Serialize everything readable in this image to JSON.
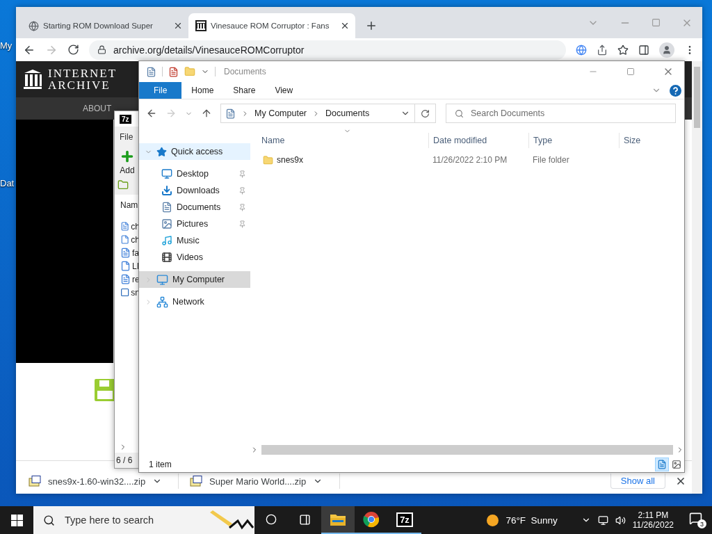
{
  "desktop": {
    "icons": [
      {
        "label": "My"
      },
      {
        "label": "Dat"
      }
    ]
  },
  "browser": {
    "tabs": [
      {
        "title": "Starting ROM Download Super",
        "selected": false
      },
      {
        "title": "Vinesauce ROM Corruptor : Fans",
        "selected": true
      }
    ],
    "url": "archive.org/details/VinesauceROMCorruptor",
    "site": {
      "logo_lines": [
        "INTERNET",
        "ARCHIVE"
      ],
      "nav": "ABOUT"
    },
    "downloads": [
      {
        "name": "snes9x-1.60-win32....zip"
      },
      {
        "name": "Super Mario World....zip"
      }
    ],
    "show_all": "Show all"
  },
  "archiver": {
    "logo": "7z",
    "menu": "File",
    "toolbar": "Add",
    "column": "Nam",
    "rows": [
      {
        "name": "ch",
        "kind": "text"
      },
      {
        "name": "ch",
        "kind": "blank"
      },
      {
        "name": "fa",
        "kind": "text"
      },
      {
        "name": "LI",
        "kind": "blank"
      },
      {
        "name": "re",
        "kind": "text"
      },
      {
        "name": "sn",
        "kind": "app"
      }
    ],
    "status": "6 / 6"
  },
  "explorer": {
    "title": "Documents",
    "ribbon_tabs": [
      {
        "label": "File",
        "selected": true
      },
      {
        "label": "Home",
        "selected": false
      },
      {
        "label": "Share",
        "selected": false
      },
      {
        "label": "View",
        "selected": false
      }
    ],
    "breadcrumb": [
      "My Computer",
      "Documents"
    ],
    "search": {
      "placeholder": "Search Documents"
    },
    "nav": [
      {
        "label": "Quick access",
        "kind": "star",
        "expanded": true,
        "selected": false,
        "hovered": true,
        "children": [
          {
            "label": "Desktop",
            "kind": "desktop",
            "pinned": true
          },
          {
            "label": "Downloads",
            "kind": "downloads",
            "pinned": true
          },
          {
            "label": "Documents",
            "kind": "documents",
            "pinned": true
          },
          {
            "label": "Pictures",
            "kind": "pictures",
            "pinned": true
          },
          {
            "label": "Music",
            "kind": "music",
            "pinned": false
          },
          {
            "label": "Videos",
            "kind": "videos",
            "pinned": false
          }
        ]
      },
      {
        "label": "My Computer",
        "kind": "computer",
        "expanded": false,
        "selected": true,
        "hovered": false
      },
      {
        "label": "Network",
        "kind": "network",
        "expanded": false,
        "selected": false,
        "hovered": false
      }
    ],
    "columns": [
      "Name",
      "Date modified",
      "Type",
      "Size"
    ],
    "files": [
      {
        "name": "snes9x",
        "date": "11/26/2022 2:10 PM",
        "type": "File folder"
      }
    ],
    "status": "1 item"
  },
  "taskbar": {
    "search": {
      "placeholder": "Type here to search"
    },
    "apps": [
      {
        "kind": "explorer",
        "active": true,
        "running": true
      },
      {
        "kind": "chrome",
        "active": false,
        "running": true
      },
      {
        "kind": "archiver",
        "label": "7z",
        "active": false,
        "running": true
      }
    ],
    "weather": "76°F  Sunny",
    "time": "2:11 PM",
    "date": "11/26/2022",
    "notifications": "3"
  }
}
